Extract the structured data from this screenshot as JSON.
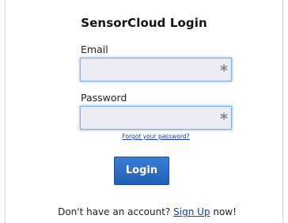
{
  "login": {
    "title": "SensorCloud Login",
    "email": {
      "label": "Email",
      "value": "",
      "placeholder": ""
    },
    "password": {
      "label": "Password",
      "value": "",
      "placeholder": ""
    },
    "forgot_password_link": "Forgot your password?",
    "login_button": "Login",
    "signup": {
      "prefix": "Don't have an account?",
      "link": "Sign Up",
      "suffix": "now!"
    }
  },
  "icons": {
    "required_indicator": "asterisk-icon"
  },
  "colors": {
    "button_bg": "#2e6fc8",
    "button_text": "#ffffff",
    "field_bg": "#ebebf5",
    "field_border": "#7faedf",
    "link": "#1a3aa8"
  }
}
